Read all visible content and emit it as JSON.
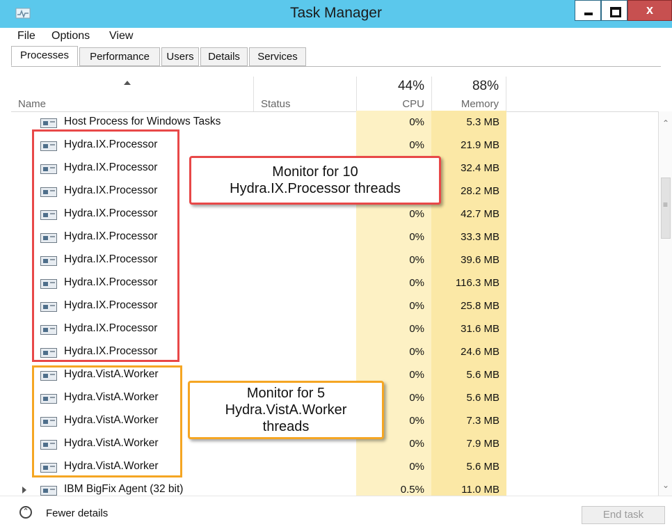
{
  "window": {
    "title": "Task Manager",
    "close_glyph": "x"
  },
  "menu": [
    "File",
    "Options",
    "View"
  ],
  "tabs": [
    "Processes",
    "Performance",
    "Users",
    "Details",
    "Services"
  ],
  "active_tab": "Processes",
  "columns": {
    "name": "Name",
    "status": "Status",
    "cpu_pct": "44%",
    "cpu": "CPU",
    "mem_pct": "88%",
    "memory": "Memory"
  },
  "processes": [
    {
      "name": "Host Process for Windows Tasks",
      "cpu": "0%",
      "memory": "5.3 MB"
    },
    {
      "name": "Hydra.IX.Processor",
      "cpu": "0%",
      "memory": "21.9 MB"
    },
    {
      "name": "Hydra.IX.Processor",
      "cpu": "",
      "memory": "32.4 MB"
    },
    {
      "name": "Hydra.IX.Processor",
      "cpu": "",
      "memory": "28.2 MB"
    },
    {
      "name": "Hydra.IX.Processor",
      "cpu": "0%",
      "memory": "42.7 MB"
    },
    {
      "name": "Hydra.IX.Processor",
      "cpu": "0%",
      "memory": "33.3 MB"
    },
    {
      "name": "Hydra.IX.Processor",
      "cpu": "0%",
      "memory": "39.6 MB"
    },
    {
      "name": "Hydra.IX.Processor",
      "cpu": "0%",
      "memory": "116.3 MB"
    },
    {
      "name": "Hydra.IX.Processor",
      "cpu": "0%",
      "memory": "25.8 MB"
    },
    {
      "name": "Hydra.IX.Processor",
      "cpu": "0%",
      "memory": "31.6 MB"
    },
    {
      "name": "Hydra.IX.Processor",
      "cpu": "0%",
      "memory": "24.6 MB"
    },
    {
      "name": "Hydra.VistA.Worker",
      "cpu": "0%",
      "memory": "5.6 MB"
    },
    {
      "name": "Hydra.VistA.Worker",
      "cpu": "0%",
      "memory": "5.6 MB"
    },
    {
      "name": "Hydra.VistA.Worker",
      "cpu": "0%",
      "memory": "7.3 MB"
    },
    {
      "name": "Hydra.VistA.Worker",
      "cpu": "0%",
      "memory": "7.9 MB"
    },
    {
      "name": "Hydra.VistA.Worker",
      "cpu": "0%",
      "memory": "5.6 MB"
    },
    {
      "name": "IBM BigFix Agent (32 bit)",
      "cpu": "0.5%",
      "memory": "11.0 MB",
      "expandable": true
    }
  ],
  "callouts": {
    "red": "Monitor for 10\nHydra.IX.Processor threads",
    "orange": "Monitor for 5\nHydra.VistA.Worker\nthreads"
  },
  "footer": {
    "fewer_details": "Fewer details",
    "end_task": "End task"
  },
  "colors": {
    "titlebar": "#5bc8ec",
    "red_highlight": "#e84848",
    "orange_highlight": "#f5a623",
    "cpu_column": "#fdf1c4",
    "memory_column": "#fbe8a6"
  },
  "icons": {
    "app": "task-manager-icon",
    "process": "process-window-icon",
    "sort": "sort-ascending-icon",
    "expand": "expand-triangle-icon",
    "fewer": "chevron-up-circle-icon"
  }
}
